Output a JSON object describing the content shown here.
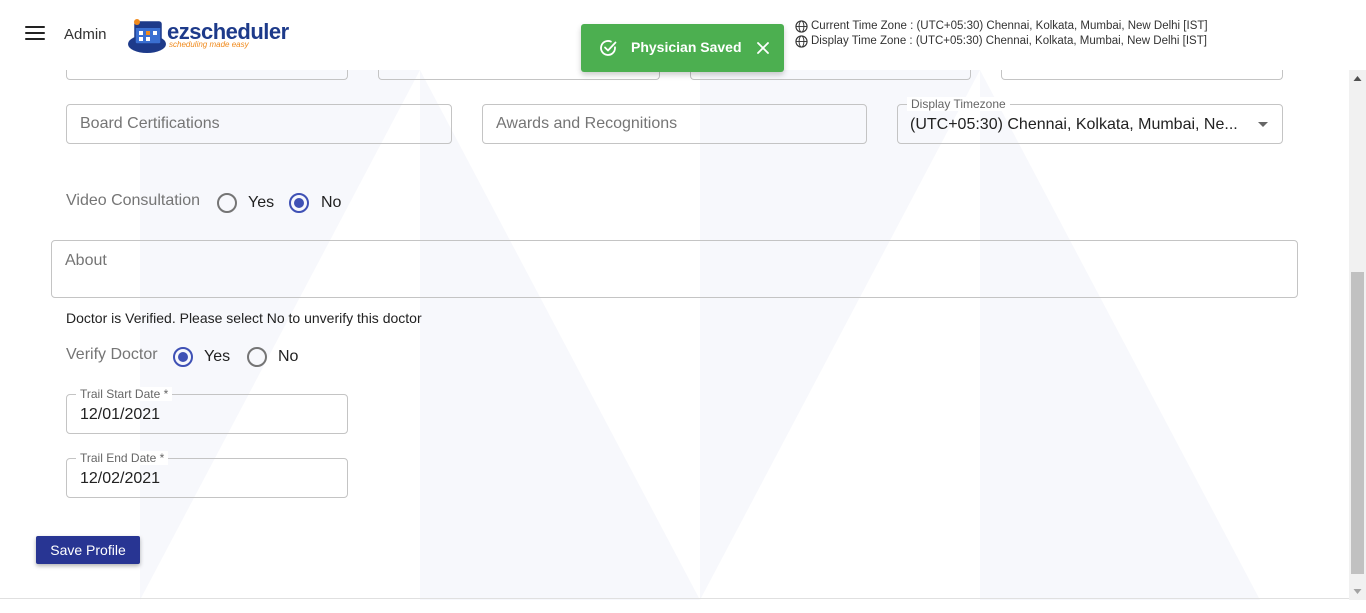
{
  "header": {
    "admin_label": "Admin",
    "logo": {
      "name": "ezscheduler",
      "prefix": "ez",
      "suffix": "scheduler",
      "tagline": "scheduling made easy"
    },
    "timezones": {
      "current": "Current Time Zone : (UTC+05:30) Chennai, Kolkata, Mumbai, New Delhi [IST]",
      "display": "Display Time Zone : (UTC+05:30) Chennai, Kolkata, Mumbai, New Delhi [IST]"
    }
  },
  "toast": {
    "message": "Physician Saved",
    "color": "#4caf50"
  },
  "form": {
    "board_certifications": {
      "placeholder": "Board Certifications"
    },
    "awards": {
      "placeholder": "Awards and Recognitions"
    },
    "display_timezone": {
      "label": "Display Timezone",
      "value": "(UTC+05:30) Chennai, Kolkata, Mumbai, Ne..."
    },
    "video_consultation": {
      "label": "Video Consultation",
      "yes": "Yes",
      "no": "No",
      "selected": "No"
    },
    "about": {
      "placeholder": "About"
    },
    "verified_note": "Doctor is Verified. Please select No to unverify this doctor",
    "verify_doctor": {
      "label": "Verify Doctor",
      "yes": "Yes",
      "no": "No",
      "selected": "Yes"
    },
    "trail_start": {
      "label": "Trail Start Date *",
      "value": "12/01/2021"
    },
    "trail_end": {
      "label": "Trail End Date *",
      "value": "12/02/2021"
    },
    "save_label": "Save Profile"
  },
  "colors": {
    "primary": "#3f51b5",
    "button": "#283593",
    "logo_blue": "#1d3a8a",
    "logo_orange": "#f08a1c"
  }
}
